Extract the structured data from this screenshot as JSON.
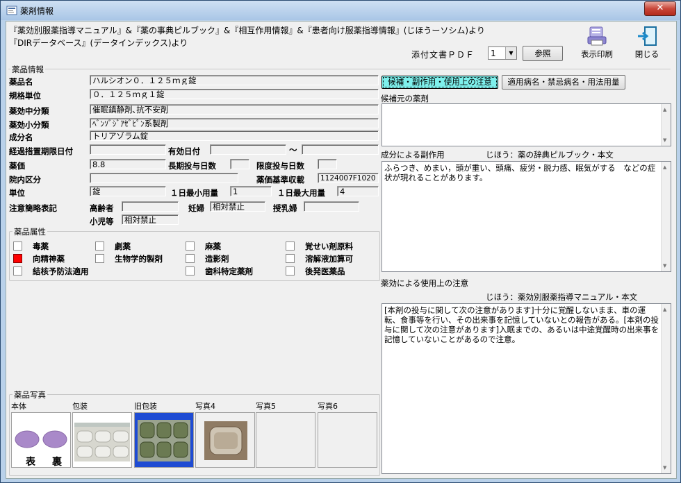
{
  "window": {
    "title": "薬剤情報",
    "close_glyph": "✕"
  },
  "source": {
    "line1": "『薬効別服薬指導マニュアル』&『薬の事典ピルブック』&『相互作用情報』&『患者向け服薬指導情報』(じほうーソシム)より",
    "line2": "『DIRデータベース』(データインデックス)より"
  },
  "pdf": {
    "label": "添付文書ＰＤＦ",
    "value": "1",
    "ref_button": "参照"
  },
  "toolbar": {
    "print": "表示印刷",
    "close": "閉じる"
  },
  "drug_info": {
    "group_title": "薬品情報",
    "name_label": "薬品名",
    "name": "ハルシオン０．１２５ｍｇ錠",
    "unit_spec_label": "規格単位",
    "unit_spec": "０．１２５ｍｇ１錠",
    "mid_class_label": "薬効中分類",
    "mid_class": "催眠鎮静剤､抗不安剤",
    "small_class_label": "薬効小分類",
    "small_class": "ﾍﾞﾝｿﾞｼﾞｱｾﾞﾋﾟﾝ系製剤",
    "ingredient_label": "成分名",
    "ingredient": "トリアゾラム錠",
    "transition_label": "経過措置期限日付",
    "transition": "",
    "expiry_label": "有効日付",
    "expiry_from": "",
    "tilde": "～",
    "expiry_to": "",
    "price_label": "薬価",
    "price": "8.8",
    "long_label": "長期投与日数",
    "long": "",
    "limit_label": "限度投与日数",
    "limit": "",
    "inhouse_label": "院内区分",
    "inhouse": "",
    "code_label": "薬価基準収載",
    "code": "1124007F1020",
    "unit_label": "単位",
    "unit": "錠",
    "daymin_label": "１日最小用量",
    "daymin": "1",
    "daymax_label": "１日最大用量",
    "daymax": "4",
    "caution_label": "注意簡略表記",
    "elderly_label": "高齢者",
    "elderly": "",
    "pregnant_label": "妊婦",
    "pregnant": "相対禁止",
    "lactating_label": "授乳婦",
    "lactating": "",
    "child_label": "小児等",
    "child": "相対禁止"
  },
  "attributes": {
    "group_title": "薬品属性",
    "items": [
      {
        "label": "毒薬",
        "checked": false
      },
      {
        "label": "劇薬",
        "checked": false
      },
      {
        "label": "麻薬",
        "checked": false
      },
      {
        "label": "覚せい剤原料",
        "checked": false
      },
      {
        "label": "向精神薬",
        "checked": true
      },
      {
        "label": "生物学的製剤",
        "checked": false
      },
      {
        "label": "造影剤",
        "checked": false
      },
      {
        "label": "溶解液加算可",
        "checked": false
      },
      {
        "label": "結核予防法適用",
        "checked": false
      },
      {
        "label": "歯科特定薬剤",
        "checked": false
      },
      {
        "label": "後発医薬品",
        "checked": false
      }
    ],
    "checked_color": "#ff0000"
  },
  "tabs": {
    "active": "候補・副作用・使用上の注意",
    "other": "適用病名・禁忌病名・用法用量"
  },
  "candidate": {
    "label": "候補元の薬剤",
    "text": ""
  },
  "side_effects": {
    "label": "成分による副作用",
    "source": "じほう：薬の辞典ピルブック・本文",
    "text": "ふらつき、めまい，頭が重い、頭痛、疲労・脱力感、眠気がする　などの症状が現れることがあります。"
  },
  "precautions": {
    "label": "薬効による使用上の注意",
    "source": "じほう：薬効別服薬指導マニュアル・本文",
    "text": "[本剤の投与に関して次の注意があります]十分に覚醒しないまま、車の運転、食事等を行い、その出来事を記憶していないとの報告がある。[本剤の投与に関して次の注意があります]入眠までの、あるいは中途覚醒時の出来事を記憶していないことがあるので注意。"
  },
  "photos": {
    "group_title": "薬品写真",
    "labels": [
      "本体",
      "包装",
      "旧包装",
      "写真4",
      "写真5",
      "写真6"
    ],
    "front": "表",
    "back": "裏",
    "tablet_color": "#a989c9"
  }
}
